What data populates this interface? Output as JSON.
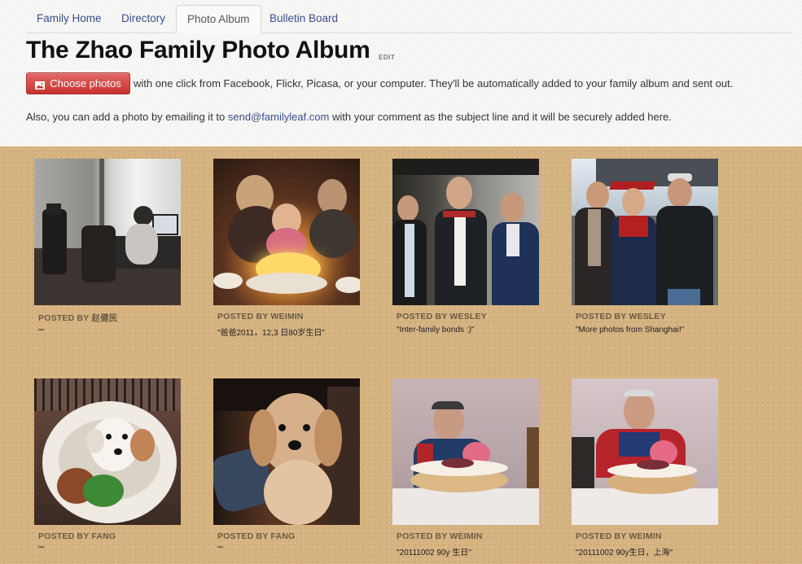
{
  "tabs": [
    {
      "label": "Family Home"
    },
    {
      "label": "Directory"
    },
    {
      "label": "Photo Album",
      "active": true
    },
    {
      "label": "Bulletin Board"
    }
  ],
  "page_title": "The Zhao Family Photo Album",
  "edit_label": "EDIT",
  "choose_button": {
    "label": "Choose photos",
    "icon": "picture-icon",
    "color": "#c9302c"
  },
  "intro_line1": "with one click from Facebook, Flickr, Picasa, or your computer. They'll be automatically added to your family album and sent out.",
  "intro_line2_prefix": "Also, you can add a photo by emailing it to",
  "email": "send@familyleaf.com",
  "intro_line2_suffix": "with your comment as the subject line and it will be securely added here.",
  "photos": [
    {
      "poster": "POSTED BY 赵健民",
      "caption": "\"\"",
      "scene": "office"
    },
    {
      "poster": "POSTED BY WEIMIN",
      "caption": "\"爸爸2011，12,3 日80岁生日\"",
      "scene": "birthday-candles"
    },
    {
      "poster": "POSTED BY WESLEY",
      "caption": "\"Inter-family bonds :)\"",
      "scene": "three-men"
    },
    {
      "poster": "POSTED BY WESLEY",
      "caption": "\"More photos from Shanghai!\"",
      "scene": "graduation"
    },
    {
      "poster": "POSTED BY FANG",
      "caption": "\"\"",
      "scene": "puppy-bed"
    },
    {
      "poster": "POSTED BY FANG",
      "caption": "\"\"",
      "scene": "puppy-face"
    },
    {
      "poster": "POSTED BY WEIMIN",
      "caption": "\"20111002 90y 生日\"",
      "scene": "cake-90-a"
    },
    {
      "poster": "POSTED BY WEIMIN",
      "caption": "\"20111002 90y生日，上海\"",
      "scene": "cake-90-b"
    }
  ],
  "colors": {
    "link": "#3a4e8c",
    "background_board": "#d5b27f",
    "button": "#c9302c"
  }
}
